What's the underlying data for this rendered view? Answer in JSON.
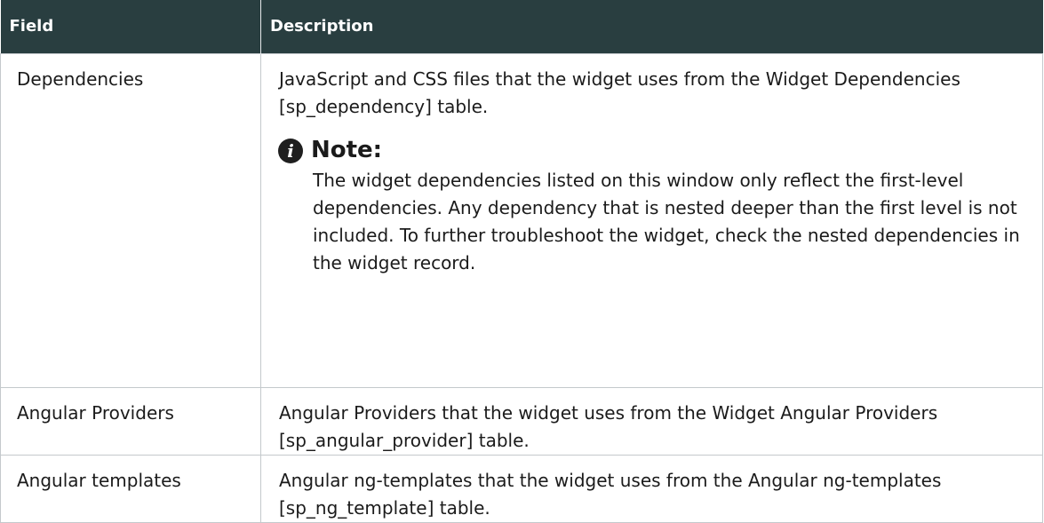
{
  "table": {
    "headers": {
      "field": "Field",
      "description": "Description"
    },
    "rows": [
      {
        "field": "Dependencies",
        "description": "JavaScript and CSS files that the widget uses from the Widget Dependencies [sp_dependency] table.",
        "note": {
          "icon": "info-icon",
          "title": "Note:",
          "body": "The widget dependencies listed on this window only reflect the first-level dependencies. Any dependency that is nested deeper than the first level is not included. To further troubleshoot the widget, check the nested dependencies in the widget record."
        }
      },
      {
        "field": "Angular Providers",
        "description": "Angular Providers that the widget uses from the Widget Angular Providers [sp_angular_provider] table."
      },
      {
        "field": "Angular templates",
        "description": "Angular ng-templates that the widget uses from the Angular ng-templates [sp_ng_template] table."
      }
    ]
  },
  "colors": {
    "header_background": "#293e40",
    "header_text": "#ffffff",
    "border": "#c4c9cc",
    "body_text": "#1b1b1b"
  }
}
